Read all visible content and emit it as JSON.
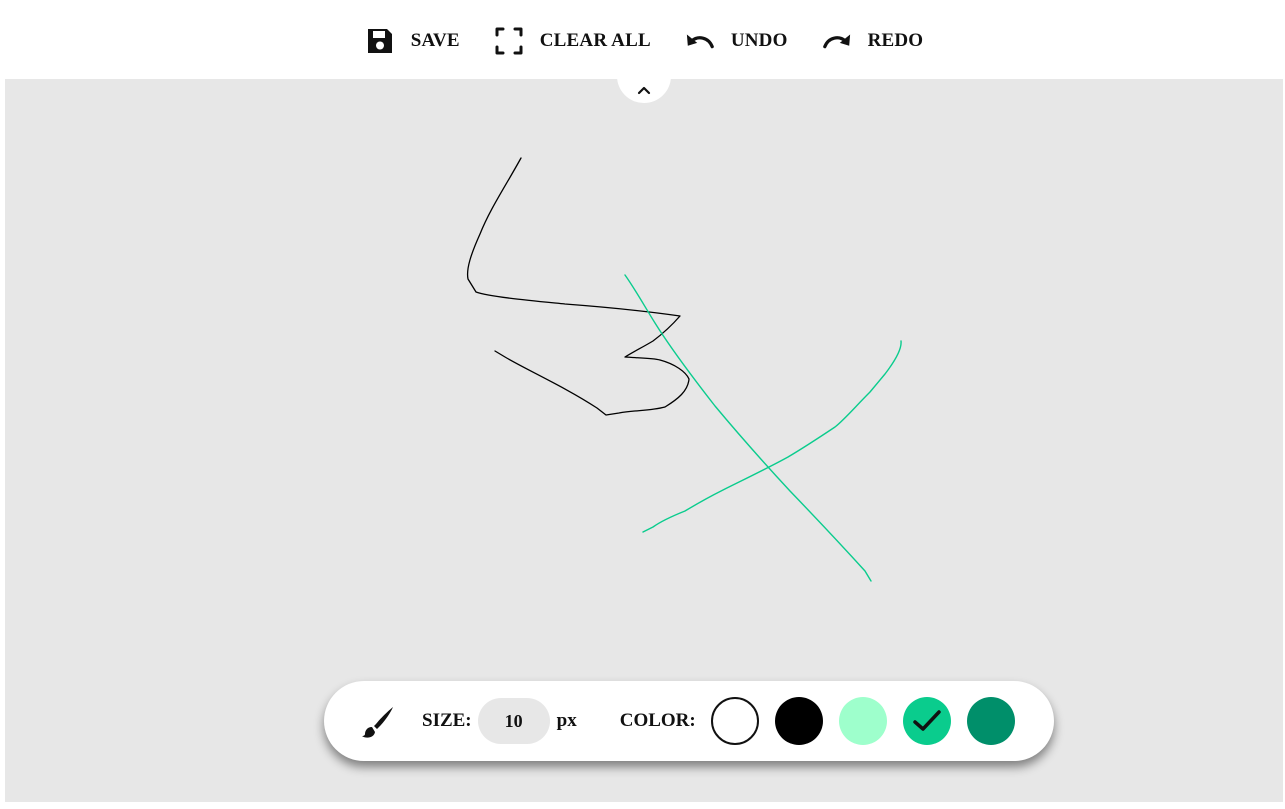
{
  "toolbar": {
    "save_label": "SAVE",
    "clear_label": "CLEAR ALL",
    "undo_label": "UNDO",
    "redo_label": "REDO"
  },
  "icons": {
    "save": "floppy-disk-icon",
    "clear": "fullscreen-corners-icon",
    "undo": "undo-arrow-icon",
    "redo": "redo-arrow-icon",
    "collapse": "chevron-up-icon",
    "brush": "paintbrush-icon",
    "selected": "checkmark-icon"
  },
  "brush_settings": {
    "size_label": "SIZE:",
    "size_value": "10",
    "size_unit": "px",
    "color_label": "COLOR:",
    "colors": [
      {
        "name": "white",
        "hex": "#ffffff",
        "selected": false
      },
      {
        "name": "black",
        "hex": "#000000",
        "selected": false
      },
      {
        "name": "light-mint",
        "hex": "#9effcc",
        "selected": false
      },
      {
        "name": "green",
        "hex": "#0acc8d",
        "selected": true
      },
      {
        "name": "dark-green",
        "hex": "#008f6a",
        "selected": false
      }
    ]
  },
  "canvas": {
    "background": "#e7e7e7",
    "stroke_colors": [
      "#000000",
      "#0acc8d"
    ]
  }
}
